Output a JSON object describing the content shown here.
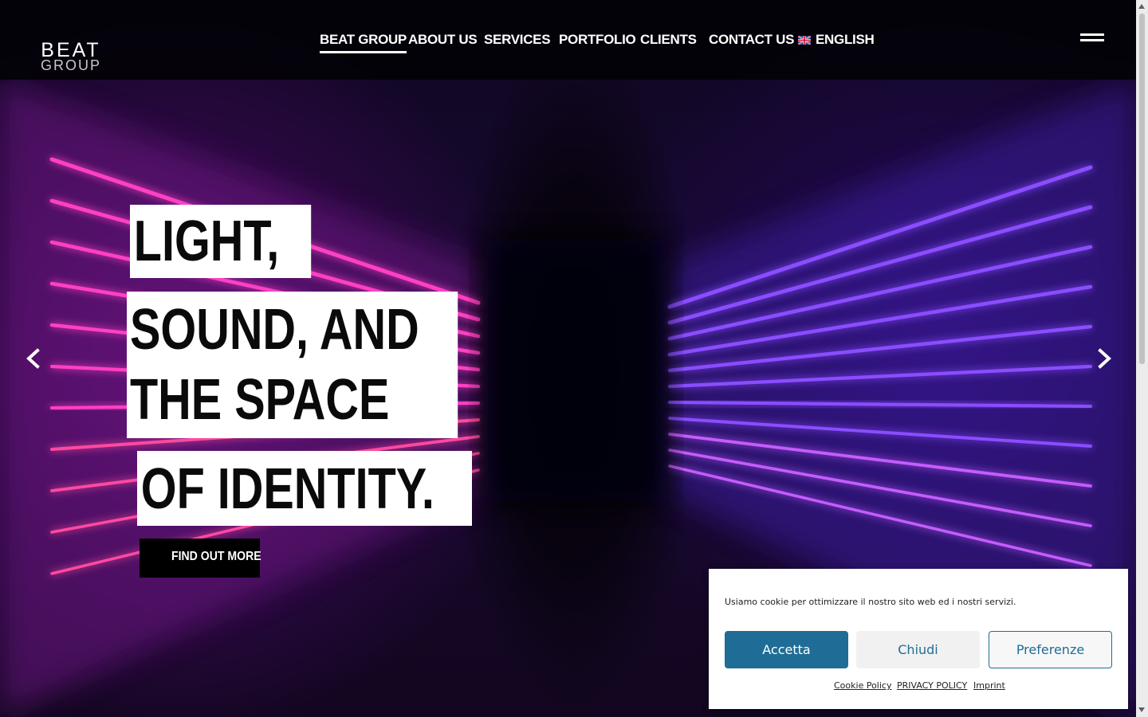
{
  "colors": {
    "accent_blue": "#1f6d96",
    "header_bg": "#030208",
    "neon_pink": "#ff3fc4",
    "neon_violet": "#8a4dff",
    "headline_bg": "#ffffff"
  },
  "header": {
    "logo": {
      "word1": "BEAT",
      "word2": "GROUP",
      "icon": "soundwave-logo-icon"
    },
    "nav": [
      {
        "label": "BEAT GROUP",
        "active": true
      },
      {
        "label": "ABOUT US"
      },
      {
        "label": "SERVICES"
      },
      {
        "label": "PORTFOLIO"
      },
      {
        "label": "CLIENTS"
      },
      {
        "label": "CONTACT US"
      },
      {
        "label": "ENGLISH",
        "icon": "uk-flag-icon"
      }
    ],
    "menu_icon": "hamburger-menu-icon"
  },
  "hero": {
    "headline_lines": [
      "LIGHT,",
      "SOUND, AND",
      "THE SPACE",
      "OF IDENTITY."
    ],
    "cta_label": "FIND OUT MORE",
    "prev_icon": "chevron-left-icon",
    "next_icon": "chevron-right-icon"
  },
  "cookie_banner": {
    "message": "Usiamo cookie per ottimizzare il nostro sito web ed i nostri servizi.",
    "accept_label": "Accetta",
    "deny_label": "Chiudi",
    "preferences_label": "Preferenze",
    "links": [
      "Cookie Policy",
      "PRIVACY POLICY",
      "Imprint"
    ]
  }
}
